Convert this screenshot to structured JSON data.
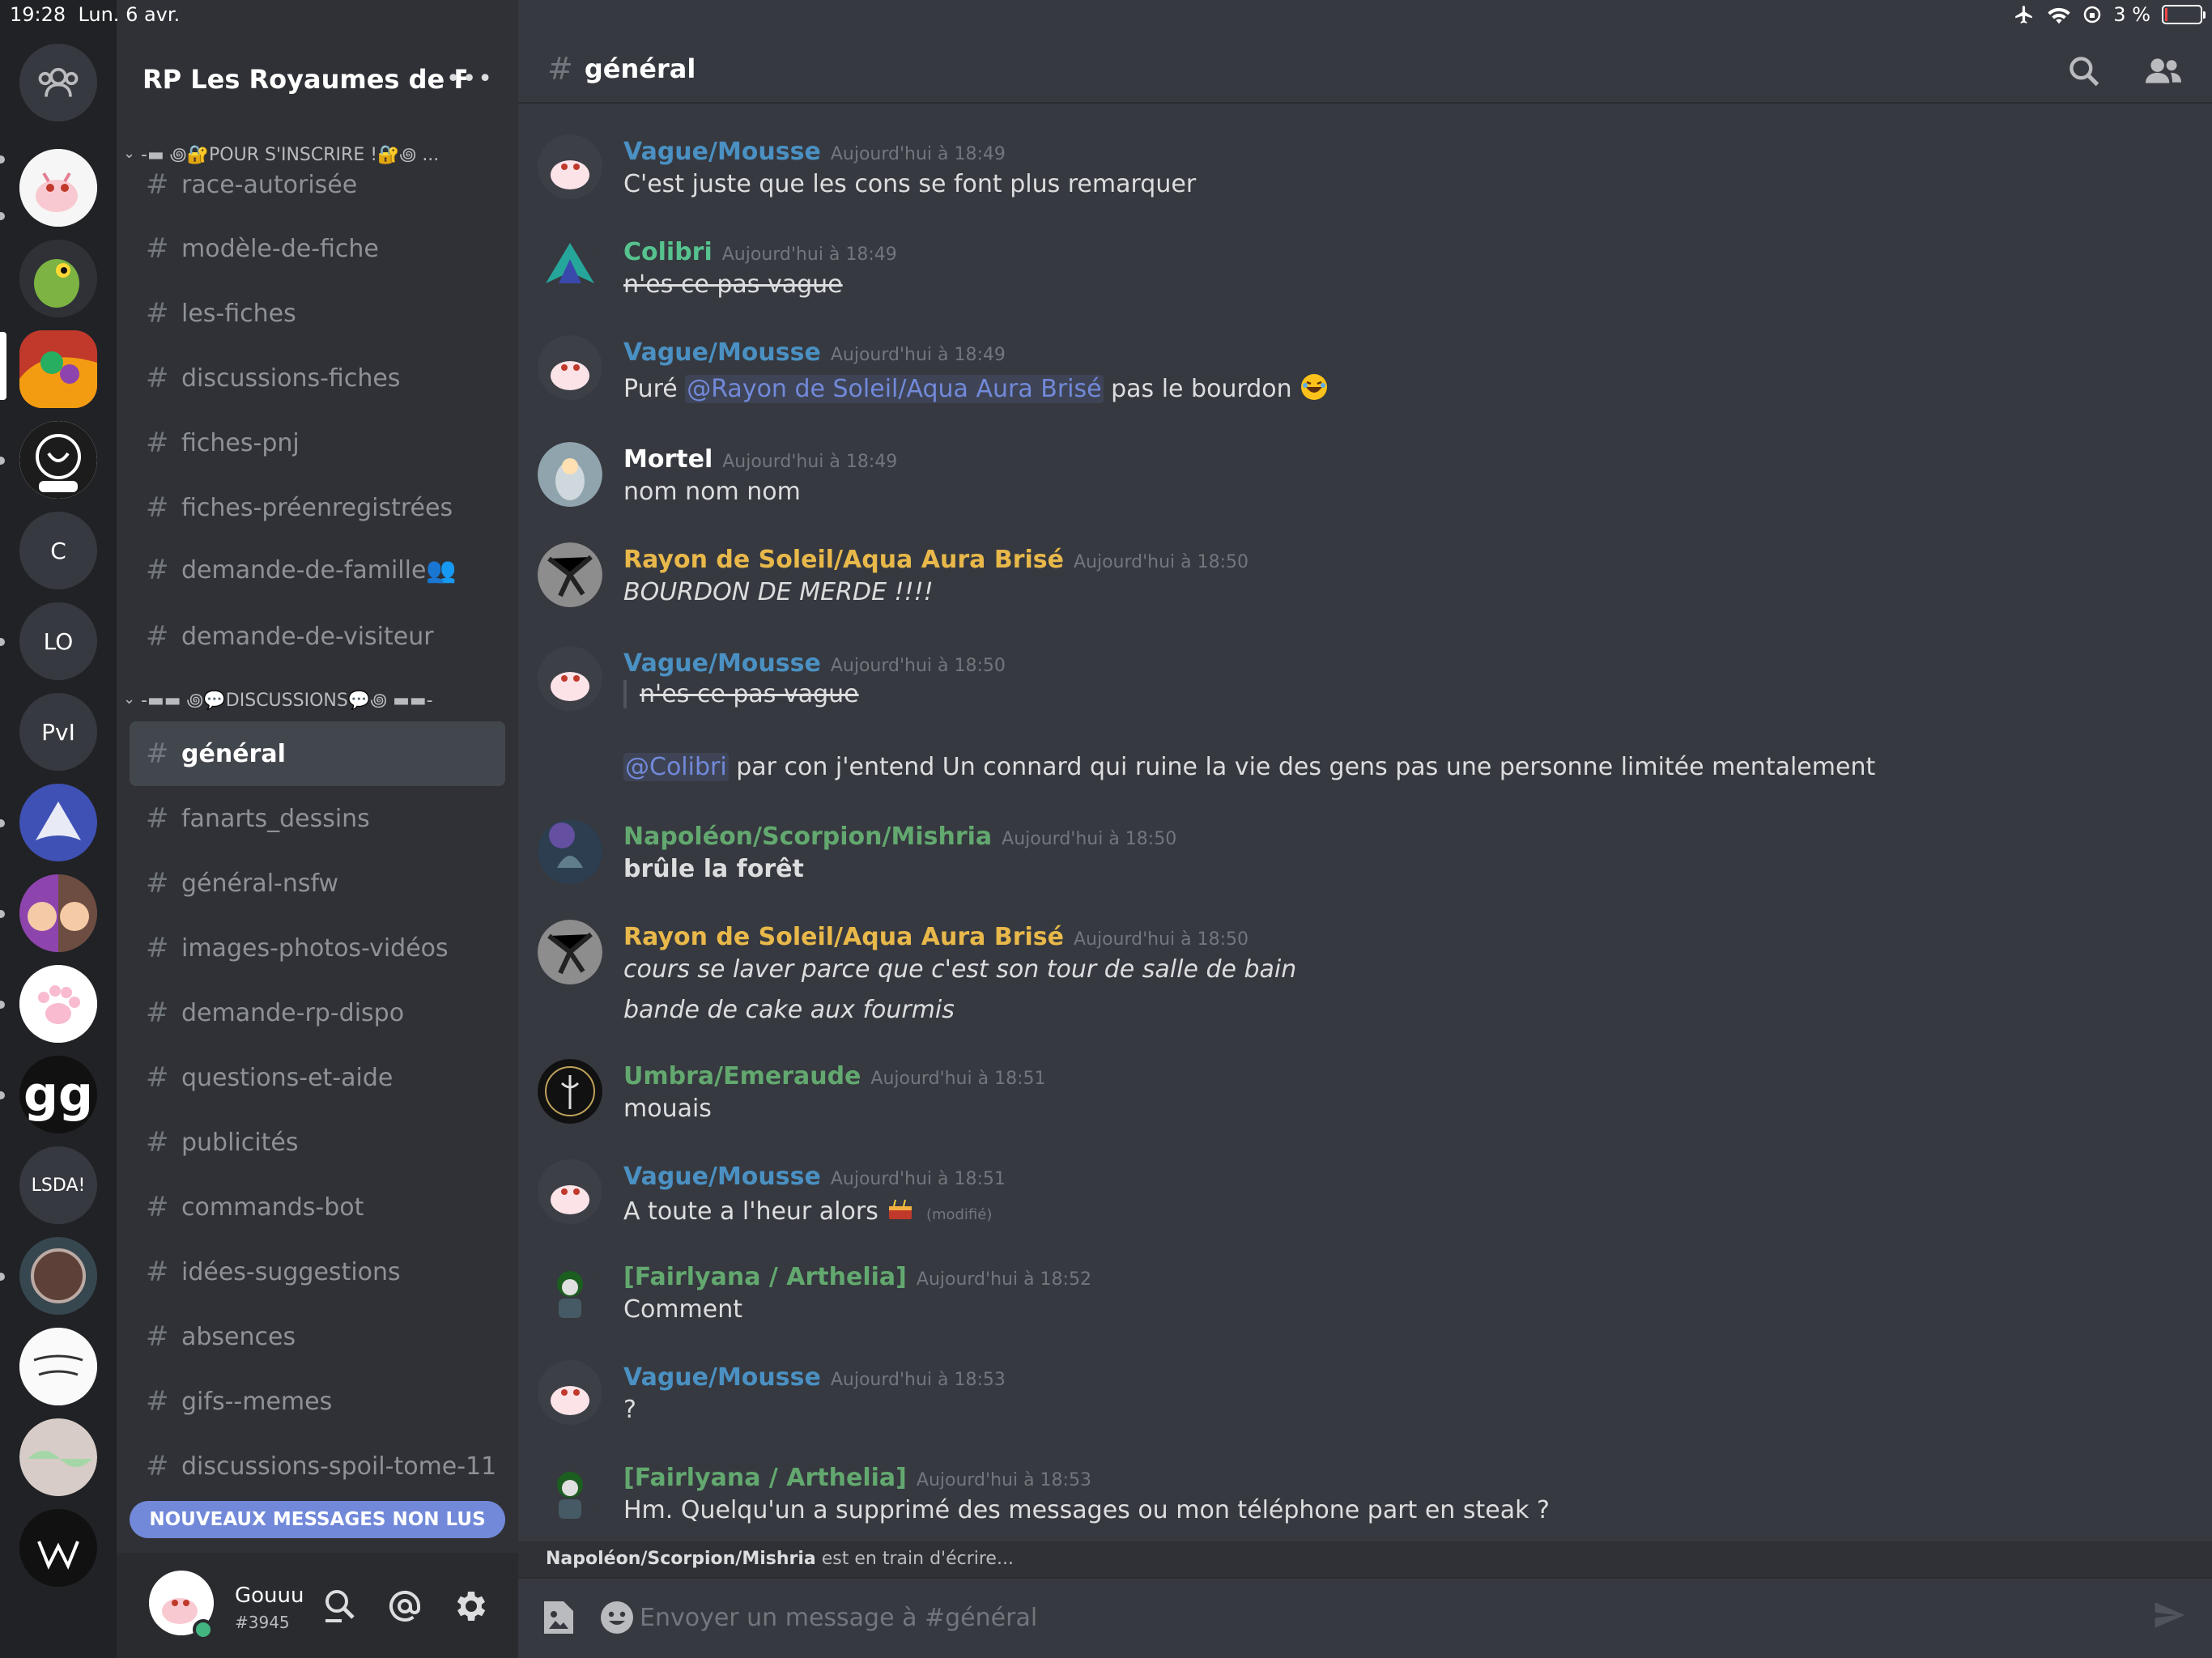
{
  "status": {
    "time": "19:28",
    "date": "Lun. 6 avr.",
    "battery": "3 %"
  },
  "rail": {
    "servers": [
      {
        "kind": "text",
        "label": "C"
      },
      {
        "kind": "text",
        "label": "LO"
      },
      {
        "kind": "text",
        "label": "PvI"
      },
      {
        "kind": "text",
        "label": "gg"
      },
      {
        "kind": "text",
        "label": "LSDA!"
      }
    ]
  },
  "guild": {
    "name": "RP Les Royaumes de F...",
    "more": "•••"
  },
  "categories": [
    {
      "label": "-▬ ꩜🔐POUR S'INSCRIRE !🔐꩜ ..."
    },
    {
      "label": "-▬▬ ꩜💬DISCUSSIONS💬꩜ ▬▬-"
    }
  ],
  "channels": [
    {
      "name": "race-autorisée"
    },
    {
      "name": "modèle-de-fiche"
    },
    {
      "name": "les-fiches"
    },
    {
      "name": "discussions-fiches"
    },
    {
      "name": "fiches-pnj"
    },
    {
      "name": "fiches-préenregistrées"
    },
    {
      "name": "demande-de-famille👥"
    },
    {
      "name": "demande-de-visiteur"
    },
    {
      "name": "général"
    },
    {
      "name": "fanarts_dessins"
    },
    {
      "name": "général-nsfw"
    },
    {
      "name": "images-photos-vidéos"
    },
    {
      "name": "demande-rp-dispo"
    },
    {
      "name": "questions-et-aide"
    },
    {
      "name": "publicités"
    },
    {
      "name": "commands-bot"
    },
    {
      "name": "idées-suggestions"
    },
    {
      "name": "absences"
    },
    {
      "name": "gifs--memes"
    },
    {
      "name": "discussions-spoil-tome-11"
    }
  ],
  "unread_banner": "NOUVEAUX MESSAGES NON LUS",
  "user": {
    "name": "Gouuu",
    "tag": "#3945"
  },
  "chat": {
    "hash": "#",
    "channel": "général",
    "typing": {
      "user": "Napoléon/Scorpion/Mishria",
      "text": " est en train d'écrire..."
    },
    "placeholder": "Envoyer un message à #général"
  },
  "messages": [
    {
      "author": "Vague/Mousse",
      "time": "Aujourd'hui à 18:49",
      "color": "#4a90c2",
      "line1": "C'est juste que les cons se font plus remarquer"
    },
    {
      "author": "Colibri",
      "time": "Aujourd'hui à 18:49",
      "color": "#56c28e",
      "line1": "n'es ce pas vague"
    },
    {
      "author": "Vague/Mousse",
      "time": "Aujourd'hui à 18:49",
      "color": "#4a90c2",
      "pre": "Puré ",
      "mention": "@Rayon de Soleil/Aqua Aura Brisé",
      "post": " pas le bourdon"
    },
    {
      "author": "Mortel",
      "time": "Aujourd'hui à 18:49",
      "color": "#ffffff",
      "line1": "nom nom nom"
    },
    {
      "author": "Rayon de Soleil/Aqua Aura Brisé",
      "time": "Aujourd'hui à 18:50",
      "color": "#e8b84a",
      "line1": "BOURDON DE MERDE !!!!"
    },
    {
      "author": "Vague/Mousse",
      "time": "Aujourd'hui à 18:50",
      "color": "#4a90c2",
      "quote": "n'es ce pas vague",
      "mention": "@Colibri",
      "post": " par con j'entend Un connard qui ruine la vie des gens pas une personne limitée mentalement"
    },
    {
      "author": "Napoléon/Scorpion/Mishria",
      "time": "Aujourd'hui à 18:50",
      "color": "#62a86f",
      "line1": "brûle la forêt"
    },
    {
      "author": "Rayon de Soleil/Aqua Aura Brisé",
      "time": "Aujourd'hui à 18:50",
      "color": "#e8b84a",
      "line1": "cours se laver parce que c'est son tour de salle de bain",
      "line2": "bande de cake aux fourmis"
    },
    {
      "author": "Umbra/Emeraude",
      "time": "Aujourd'hui à 18:51",
      "color": "#62a86f",
      "line1": "mouais"
    },
    {
      "author": "Vague/Mousse",
      "time": "Aujourd'hui à 18:51",
      "color": "#4a90c2",
      "line1": "A toute a l'heur alors",
      "edited": "(modifié)"
    },
    {
      "author": "[Fairlyana / Arthelia]",
      "time": "Aujourd'hui à 18:52",
      "color": "#62a86f",
      "line1": "Comment"
    },
    {
      "author": "Vague/Mousse",
      "time": "Aujourd'hui à 18:53",
      "color": "#4a90c2",
      "line1": "?"
    },
    {
      "author": "[Fairlyana / Arthelia]",
      "time": "Aujourd'hui à 18:53",
      "color": "#62a86f",
      "line1": "Hm. Quelqu'un a supprimé des messages ou mon téléphone part en steak ?"
    }
  ]
}
